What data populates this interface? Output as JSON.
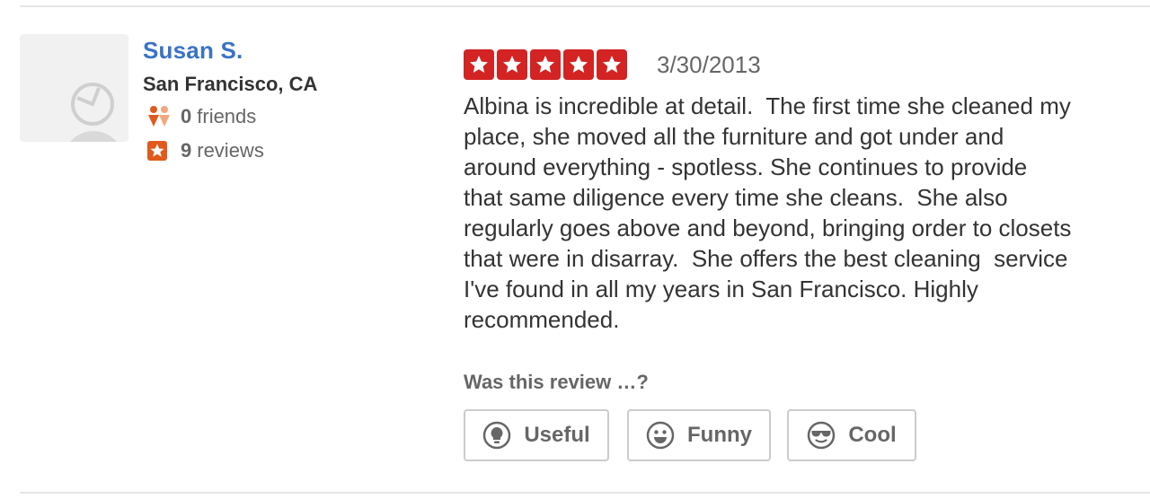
{
  "user": {
    "name": "Susan S.",
    "location": "San Francisco, CA",
    "friends_count": "0",
    "friends_label": "friends",
    "reviews_count": "9",
    "reviews_label": "reviews"
  },
  "review": {
    "rating": 5,
    "rating_max": 5,
    "date": "3/30/2013",
    "text": "Albina is incredible at detail.  The first time she cleaned my\nplace, she moved all the furniture and got under and\naround everything - spotless. She continues to provide\nthat same diligence every time she cleans.  She also\nregularly goes above and beyond, bringing order to closets\nthat were in disarray.  She offers the best cleaning  service\nI've found in all my years in San Francisco. Highly\nrecommended."
  },
  "votes": {
    "prompt": "Was this review …?",
    "useful_label": "Useful",
    "funny_label": "Funny",
    "cool_label": "Cool"
  },
  "colors": {
    "link_blue": "#3a73c4",
    "star_red": "#d32323",
    "accent_orange": "#e05a1e",
    "muted_text": "#666666",
    "border_gray": "#cccccc"
  },
  "icons": [
    "default-avatar-icon",
    "friends-icon",
    "review-star-icon",
    "star-icon",
    "lightbulb-icon",
    "smile-icon",
    "sunglasses-icon"
  ]
}
